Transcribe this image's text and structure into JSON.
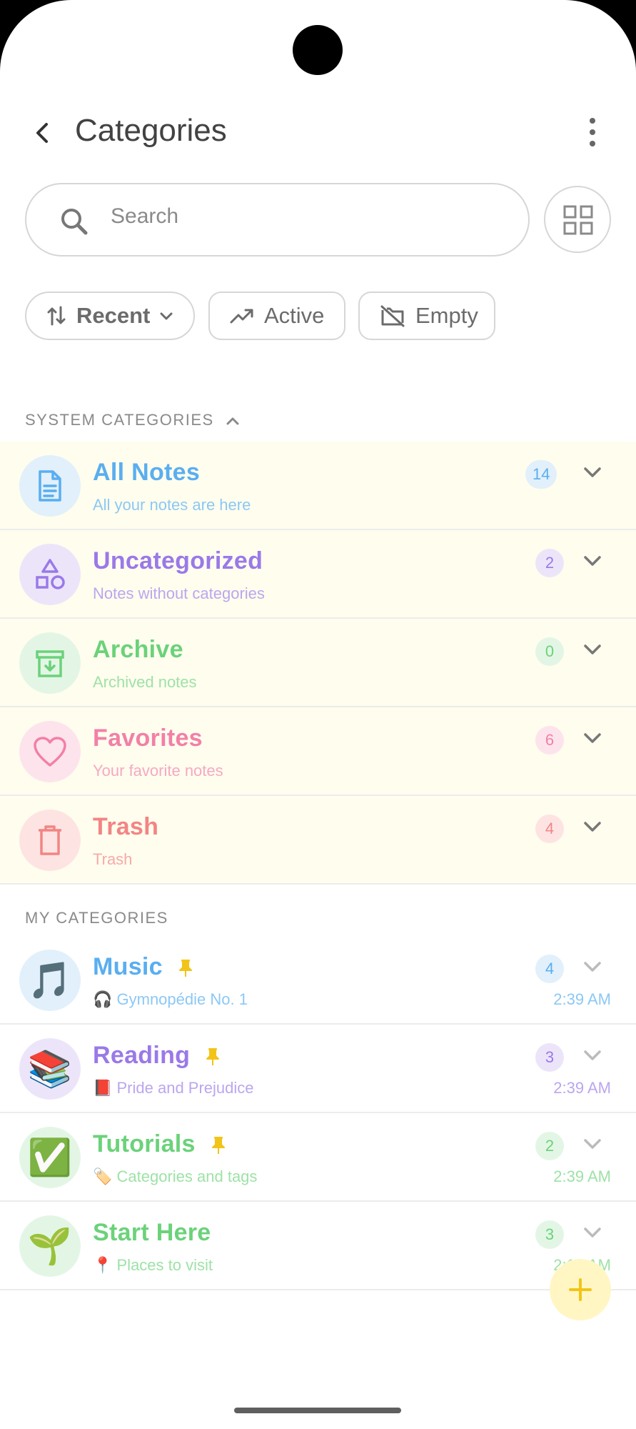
{
  "header": {
    "title": "Categories"
  },
  "search": {
    "placeholder": "Search"
  },
  "filters": {
    "recent": "Recent",
    "active": "Active",
    "empty": "Empty"
  },
  "system": {
    "label": "SYSTEM CATEGORIES",
    "items": [
      {
        "title": "All Notes",
        "subtitle": "All your notes are here",
        "count": "14",
        "color": "#5aaef0",
        "bg": "#e1f0fb",
        "icon": "document-icon"
      },
      {
        "title": "Uncategorized",
        "subtitle": "Notes without categories",
        "count": "2",
        "color": "#9a79e8",
        "bg": "#ece5fa",
        "icon": "shapes-icon"
      },
      {
        "title": "Archive",
        "subtitle": "Archived notes",
        "count": "0",
        "color": "#6bd27a",
        "bg": "#e3f6e5",
        "icon": "archive-icon"
      },
      {
        "title": "Favorites",
        "subtitle": "Your favorite notes",
        "count": "6",
        "color": "#f280a8",
        "bg": "#fde4ec",
        "icon": "heart-icon"
      },
      {
        "title": "Trash",
        "subtitle": "Trash",
        "count": "4",
        "color": "#f28585",
        "bg": "#fde4e3",
        "icon": "trash-icon"
      }
    ]
  },
  "mine": {
    "label": "MY CATEGORIES",
    "items": [
      {
        "title": "Music",
        "emoji": "🎵",
        "subtitle": "🎧 Gymnopédie No. 1",
        "count": "4",
        "time": "2:39 AM",
        "color": "#5aaef0",
        "bg": "#e1f0fb"
      },
      {
        "title": "Reading",
        "emoji": "📚",
        "subtitle": "📕 Pride and Prejudice",
        "count": "3",
        "time": "2:39 AM",
        "color": "#9a79e8",
        "bg": "#ece5fa"
      },
      {
        "title": "Tutorials",
        "emoji": "✅",
        "subtitle": "🏷️ Categories and tags",
        "count": "2",
        "time": "2:39 AM",
        "color": "#6bd27a",
        "bg": "#e3f6e5"
      },
      {
        "title": "Start Here",
        "emoji": "🌱",
        "subtitle": "📍 Places to visit",
        "count": "3",
        "time": "2:15 AM",
        "color": "#6bd27a",
        "bg": "#e3f6e5"
      }
    ]
  }
}
